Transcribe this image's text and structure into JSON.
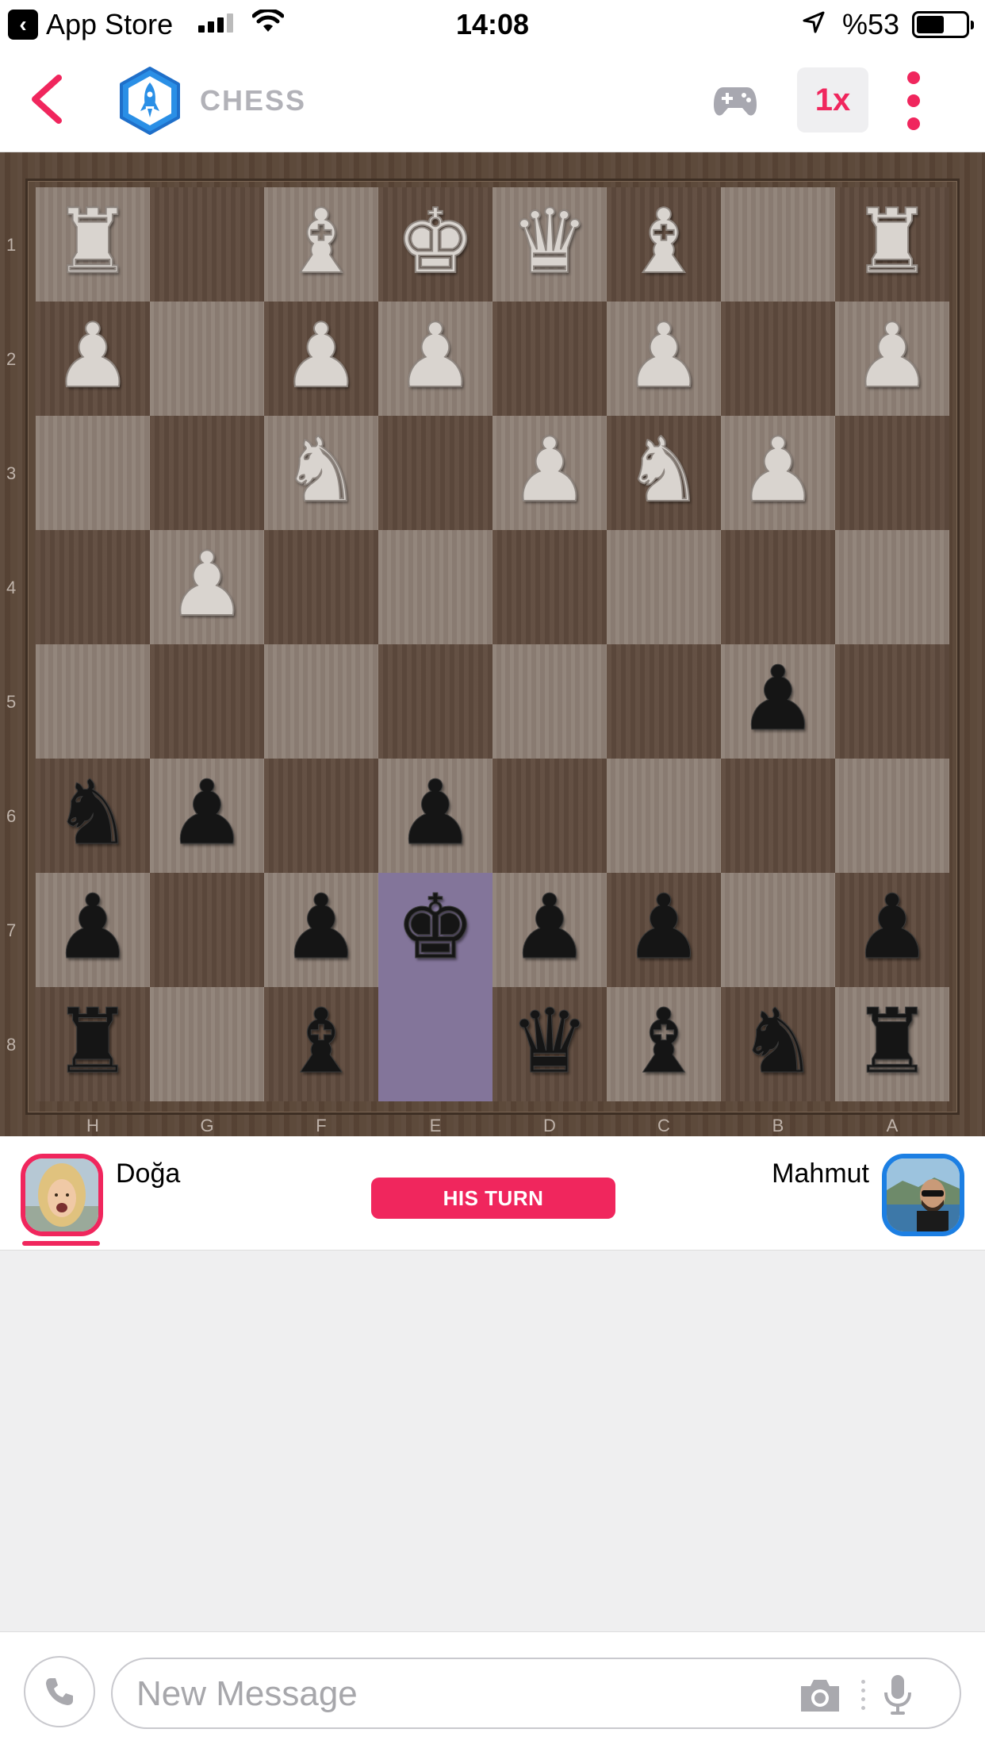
{
  "status_bar": {
    "back_app": "App Store",
    "time": "14:08",
    "battery": "%53"
  },
  "header": {
    "title": "CHESS",
    "speed": "1x",
    "accent": "#f0265d"
  },
  "board": {
    "ranks": [
      "1",
      "2",
      "3",
      "4",
      "5",
      "6",
      "7",
      "8"
    ],
    "files": [
      "H",
      "G",
      "F",
      "E",
      "D",
      "C",
      "B",
      "A"
    ],
    "highlighted_squares": [
      "7-3",
      "8-3"
    ],
    "rows": [
      [
        {
          "p": "♜",
          "c": "w"
        },
        {
          "p": "",
          "c": ""
        },
        {
          "p": "♝",
          "c": "w"
        },
        {
          "p": "♚",
          "c": "w"
        },
        {
          "p": "♛",
          "c": "w"
        },
        {
          "p": "♝",
          "c": "w"
        },
        {
          "p": "",
          "c": ""
        },
        {
          "p": "♜",
          "c": "w"
        }
      ],
      [
        {
          "p": "♟",
          "c": "w"
        },
        {
          "p": "",
          "c": ""
        },
        {
          "p": "♟",
          "c": "w"
        },
        {
          "p": "♟",
          "c": "w"
        },
        {
          "p": "",
          "c": ""
        },
        {
          "p": "♟",
          "c": "w"
        },
        {
          "p": "",
          "c": ""
        },
        {
          "p": "♟",
          "c": "w"
        }
      ],
      [
        {
          "p": "",
          "c": ""
        },
        {
          "p": "",
          "c": ""
        },
        {
          "p": "♞",
          "c": "w"
        },
        {
          "p": "",
          "c": ""
        },
        {
          "p": "♟",
          "c": "w"
        },
        {
          "p": "♞",
          "c": "w"
        },
        {
          "p": "♟",
          "c": "w"
        },
        {
          "p": "",
          "c": ""
        }
      ],
      [
        {
          "p": "",
          "c": ""
        },
        {
          "p": "♟",
          "c": "w"
        },
        {
          "p": "",
          "c": ""
        },
        {
          "p": "",
          "c": ""
        },
        {
          "p": "",
          "c": ""
        },
        {
          "p": "",
          "c": ""
        },
        {
          "p": "",
          "c": ""
        },
        {
          "p": "",
          "c": ""
        }
      ],
      [
        {
          "p": "",
          "c": ""
        },
        {
          "p": "",
          "c": ""
        },
        {
          "p": "",
          "c": ""
        },
        {
          "p": "",
          "c": ""
        },
        {
          "p": "",
          "c": ""
        },
        {
          "p": "",
          "c": ""
        },
        {
          "p": "♟",
          "c": "b"
        },
        {
          "p": "",
          "c": ""
        }
      ],
      [
        {
          "p": "♞",
          "c": "b"
        },
        {
          "p": "♟",
          "c": "b"
        },
        {
          "p": "",
          "c": ""
        },
        {
          "p": "♟",
          "c": "b"
        },
        {
          "p": "",
          "c": ""
        },
        {
          "p": "",
          "c": ""
        },
        {
          "p": "",
          "c": ""
        },
        {
          "p": "",
          "c": ""
        }
      ],
      [
        {
          "p": "♟",
          "c": "b"
        },
        {
          "p": "",
          "c": ""
        },
        {
          "p": "♟",
          "c": "b"
        },
        {
          "p": "♚",
          "c": "b"
        },
        {
          "p": "♟",
          "c": "b"
        },
        {
          "p": "♟",
          "c": "b"
        },
        {
          "p": "",
          "c": ""
        },
        {
          "p": "♟",
          "c": "b"
        }
      ],
      [
        {
          "p": "♜",
          "c": "b"
        },
        {
          "p": "",
          "c": ""
        },
        {
          "p": "♝",
          "c": "b"
        },
        {
          "p": "",
          "c": ""
        },
        {
          "p": "♛",
          "c": "b"
        },
        {
          "p": "♝",
          "c": "b"
        },
        {
          "p": "♞",
          "c": "b"
        },
        {
          "p": "♜",
          "c": "b"
        }
      ]
    ]
  },
  "players": {
    "left": {
      "name": "Doğa",
      "ring_color": "#f0265d"
    },
    "right": {
      "name": "Mahmut",
      "ring_color": "#1c7fe3"
    },
    "turn_label": "HIS TURN"
  },
  "composer": {
    "placeholder": "New Message",
    "icons": [
      "phone-icon",
      "camera-icon",
      "mic-icon"
    ]
  }
}
